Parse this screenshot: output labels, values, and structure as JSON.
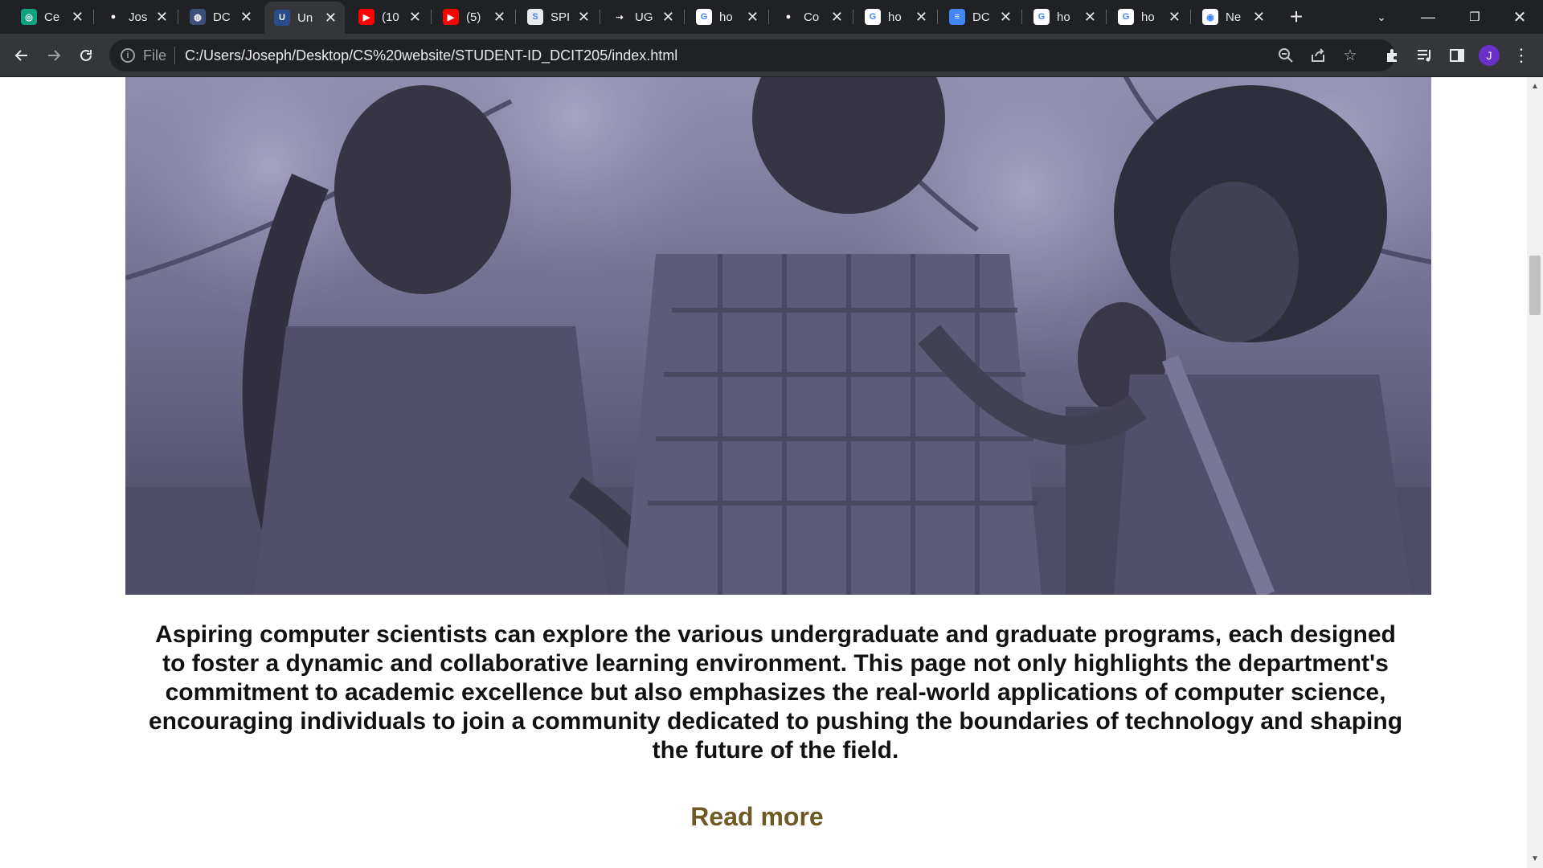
{
  "tabs": [
    {
      "title": "Ce",
      "icon": "chatgpt-icon",
      "icon_bg": "#10a37f",
      "glyph": "◎"
    },
    {
      "title": "Jos",
      "icon": "github-icon",
      "icon_bg": "#202124",
      "glyph": "●"
    },
    {
      "title": "DC",
      "icon": "globe-icon",
      "icon_bg": "#3c4f7a",
      "glyph": "◍"
    },
    {
      "title": "Un",
      "icon": "university-crest-icon",
      "icon_bg": "#2b4c8c",
      "glyph": "U",
      "active": true
    },
    {
      "title": "(10",
      "icon": "youtube-icon",
      "icon_bg": "#ff0000",
      "glyph": "▶"
    },
    {
      "title": "(5)",
      "icon": "youtube-icon",
      "icon_bg": "#ff0000",
      "glyph": "▶"
    },
    {
      "title": "SPI",
      "icon": "spi-logo-icon",
      "icon_bg": "#e8eaed",
      "glyph": "S"
    },
    {
      "title": "UG",
      "icon": "ug-logo-icon",
      "icon_bg": "#202124",
      "glyph": "⇢"
    },
    {
      "title": "ho",
      "icon": "google-icon",
      "icon_bg": "#ffffff",
      "glyph": "G"
    },
    {
      "title": "Co",
      "icon": "github-icon",
      "icon_bg": "#202124",
      "glyph": "●"
    },
    {
      "title": "ho",
      "icon": "google-icon",
      "icon_bg": "#ffffff",
      "glyph": "G"
    },
    {
      "title": "DC",
      "icon": "google-docs-icon",
      "icon_bg": "#4285f4",
      "glyph": "≡"
    },
    {
      "title": "ho",
      "icon": "google-icon",
      "icon_bg": "#ffffff",
      "glyph": "G"
    },
    {
      "title": "ho",
      "icon": "google-icon",
      "icon_bg": "#ffffff",
      "glyph": "G"
    },
    {
      "title": "Ne",
      "icon": "chrome-icon",
      "icon_bg": "#ffffff",
      "glyph": "◉"
    }
  ],
  "toolbar": {
    "scheme_label": "File",
    "url": "C:/Users/Joseph/Desktop/CS%20website/STUDENT-ID_DCIT205/index.html",
    "profile_initial": "J"
  },
  "content": {
    "description": "Aspiring computer scientists can explore the various undergraduate and graduate programs, each designed to foster a dynamic and collaborative learning environment. This page not only highlights the department's commitment to academic excellence but also emphasizes the real-world applications of computer science, encouraging individuals to join a community dedicated to pushing the boundaries of technology and shaping the future of the field.",
    "read_more": "Read more",
    "accent_color": "#6e5a24"
  }
}
